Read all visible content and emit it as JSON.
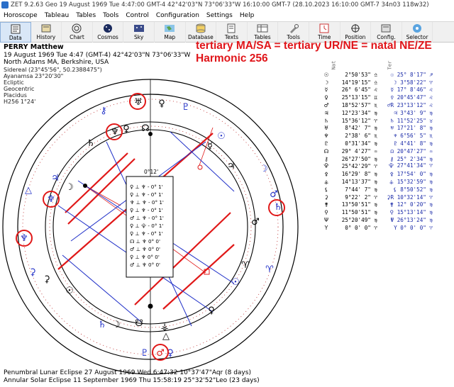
{
  "window": {
    "title": "ZET 9.2.63 Geo    19 August 1969  Tue    4:47:00 GMT-4 42°42'03\"N  73°06'33\"W    16:10:00 GMT-7 (28.10.2023   16:10:00 GMT-7 34n03 118w32)"
  },
  "menu": [
    "Horoscope",
    "Tableau",
    "Tables",
    "Tools",
    "Control",
    "Configuration",
    "Settings",
    "Help"
  ],
  "toolbar": [
    {
      "label": "Data",
      "icon": "data-icon",
      "active": true
    },
    {
      "label": "History",
      "icon": "history-icon"
    },
    {
      "label": "Chart",
      "icon": "chart-icon"
    },
    {
      "label": "Cosmos",
      "icon": "cosmos-icon"
    },
    {
      "label": "Sky",
      "icon": "sky-icon"
    },
    {
      "label": "Map",
      "icon": "map-icon"
    },
    {
      "label": "Database",
      "icon": "database-icon"
    },
    {
      "label": "Texts",
      "icon": "texts-icon"
    },
    {
      "label": "Tables",
      "icon": "tables-icon"
    },
    {
      "label": "Tools",
      "icon": "tools-icon"
    },
    {
      "label": "Time",
      "icon": "time-icon"
    },
    {
      "label": "Position",
      "icon": "position-icon"
    },
    {
      "label": "Config.",
      "icon": "config-icon"
    },
    {
      "label": "Selector",
      "icon": "selector-icon"
    }
  ],
  "chart_info": {
    "name": "PERRY Matthew",
    "date_line": "19 August 1969  Tue   4:47 (GMT-4) 42°42'03\"N  73°06'33\"W",
    "place": "North Adams MA, Berkshire, USA",
    "sidereal": "Sidereal (23°45'56\", 50.2388475\")",
    "ayanamsa": "Ayanamsa 23°20'30\"",
    "ecliptic": "Ecliptic",
    "geocentric": "Geocentric",
    "placidus": "Placidus",
    "harmonic_line": "H256  1°24'"
  },
  "headline": {
    "line1": "tertiary MA/SA = tertiary UR/NE = natal NE/ZE",
    "line2": "Harmonic 256"
  },
  "aspect_box": {
    "orb_label": "0°12'",
    "rows": [
      "♀ ⊥ ♆ - 0° 1'",
      "♀ ⊥ ♆ - 0° 1'",
      "♆ ⊥ ♆ - 0° 1'",
      "♀ ⊥ ♆ - 0° 1'",
      "♂ ⊥ ♆ - 0° 1'",
      "♀ ⊥ ⯓ - 0° 1'",
      "♀ ⊥ ♆ - 0° 1'",
      "☊ ⊥ ♆   0° 0'",
      "♂ ⊥ ♆   0° 0'",
      "♀ ⊥ ♆   0° 0'",
      "♂ ⊥ ♆   0° 0'"
    ]
  },
  "positions": {
    "col_natal": "Nat",
    "col_ter": "Ter",
    "rows": [
      {
        "p": "☉",
        "nat": "2°50'53\"",
        "ns": "♎",
        "tp": "☉",
        "ter": "25° 8'17\"",
        "ts": "♐"
      },
      {
        "p": "☽",
        "nat": "14°19'15\"",
        "ns": "♎",
        "tp": "☽",
        "ter": "3°58'22\"",
        "ts": "♈"
      },
      {
        "p": "☿",
        "nat": "26° 6'45\"",
        "ns": "♌",
        "tp": "☿",
        "ter": "17° 8'46\"",
        "ts": "♌"
      },
      {
        "p": "♀",
        "nat": "25°13'15\"",
        "ns": "♊",
        "tp": "♀",
        "ter": "20°45'47\"",
        "ts": "♌"
      },
      {
        "p": "♂",
        "nat": "18°52'57\"",
        "ns": "♏",
        "tp": "♂R",
        "ter": "23°13'12\"",
        "ts": "♌"
      },
      {
        "p": "♃",
        "nat": "12°23'34\"",
        "ns": "♍",
        "tp": "♃",
        "ter": "3°43' 9\"",
        "ts": "♍"
      },
      {
        "p": "♄",
        "nat": "15°36'12\"",
        "ns": "♈",
        "tp": "♄",
        "ter": "11°52'25\"",
        "ts": "♉"
      },
      {
        "p": "♅",
        "nat": "8°42' 7\"",
        "ns": "♍",
        "tp": "♅",
        "ter": "17°21' 8\"",
        "ts": "♍"
      },
      {
        "p": "♆",
        "nat": "2°38' 6\"",
        "ns": "♏",
        "tp": "♆",
        "ter": "6°56' 5\"",
        "ts": "♏"
      },
      {
        "p": "♇",
        "nat": "0°31'34\"",
        "ns": "♍",
        "tp": "♇",
        "ter": "4°41' 8\"",
        "ts": "♍"
      },
      {
        "p": "☊",
        "nat": "29° 4'27\"",
        "ns": "♒",
        "tp": "☊",
        "ter": "20°47'27\"",
        "ts": "♒"
      },
      {
        "p": "⚷",
        "nat": "26°27'50\"",
        "ns": "♍",
        "tp": "⚷",
        "ter": "25° 2'34\"",
        "ts": "♍"
      },
      {
        "p": "⯓",
        "nat": "25°42'29\"",
        "ns": "♈",
        "tp": "⯓",
        "ter": "27°41'34\"",
        "ts": "♈"
      },
      {
        "p": "⚴",
        "nat": "16°29' 8\"",
        "ns": "♍",
        "tp": "⚴",
        "ter": "17°54' 0\"",
        "ts": "♍"
      },
      {
        "p": "⚶",
        "nat": "14°13'37\"",
        "ns": "♍",
        "tp": "⚶",
        "ter": "15°32'59\"",
        "ts": "♍"
      },
      {
        "p": "⚸",
        "nat": "7°44' 7\"",
        "ns": "♍",
        "tp": "⚸",
        "ter": "8°50'52\"",
        "ts": "♍"
      },
      {
        "p": "⚳",
        "nat": "9°22' 2\"",
        "ns": "♈",
        "tp": "⚳R",
        "ter": "10°32'14\"",
        "ts": "♈"
      },
      {
        "p": "⚵",
        "nat": "13°50'51\"",
        "ns": "♍",
        "tp": "⚵",
        "ter": "12° 0'20\"",
        "ts": "♍"
      },
      {
        "p": "⚲",
        "nat": "11°50'51\"",
        "ns": "♍",
        "tp": "⚲",
        "ter": "15°13'14\"",
        "ts": "♍"
      },
      {
        "p": "Ψ",
        "nat": "25°20'49\"",
        "ns": "♍",
        "tp": "Ψ",
        "ter": "26°13'24\"",
        "ts": "♍"
      },
      {
        "p": "Υ",
        "nat": "0° 0' 0\"",
        "ns": "♈",
        "tp": "Υ",
        "ter": "0° 0' 0\"",
        "ts": "♈"
      }
    ]
  },
  "footer": {
    "line1": "Penumbral Lunar Eclipse 27 August 1969 Wed  6:47:32 10°37'47\"Aqr (8 days)",
    "line2": "Annular Solar Eclipse 11 September 1969 Thu 15:58:19 25°32'52\"Leo (23 days)"
  }
}
